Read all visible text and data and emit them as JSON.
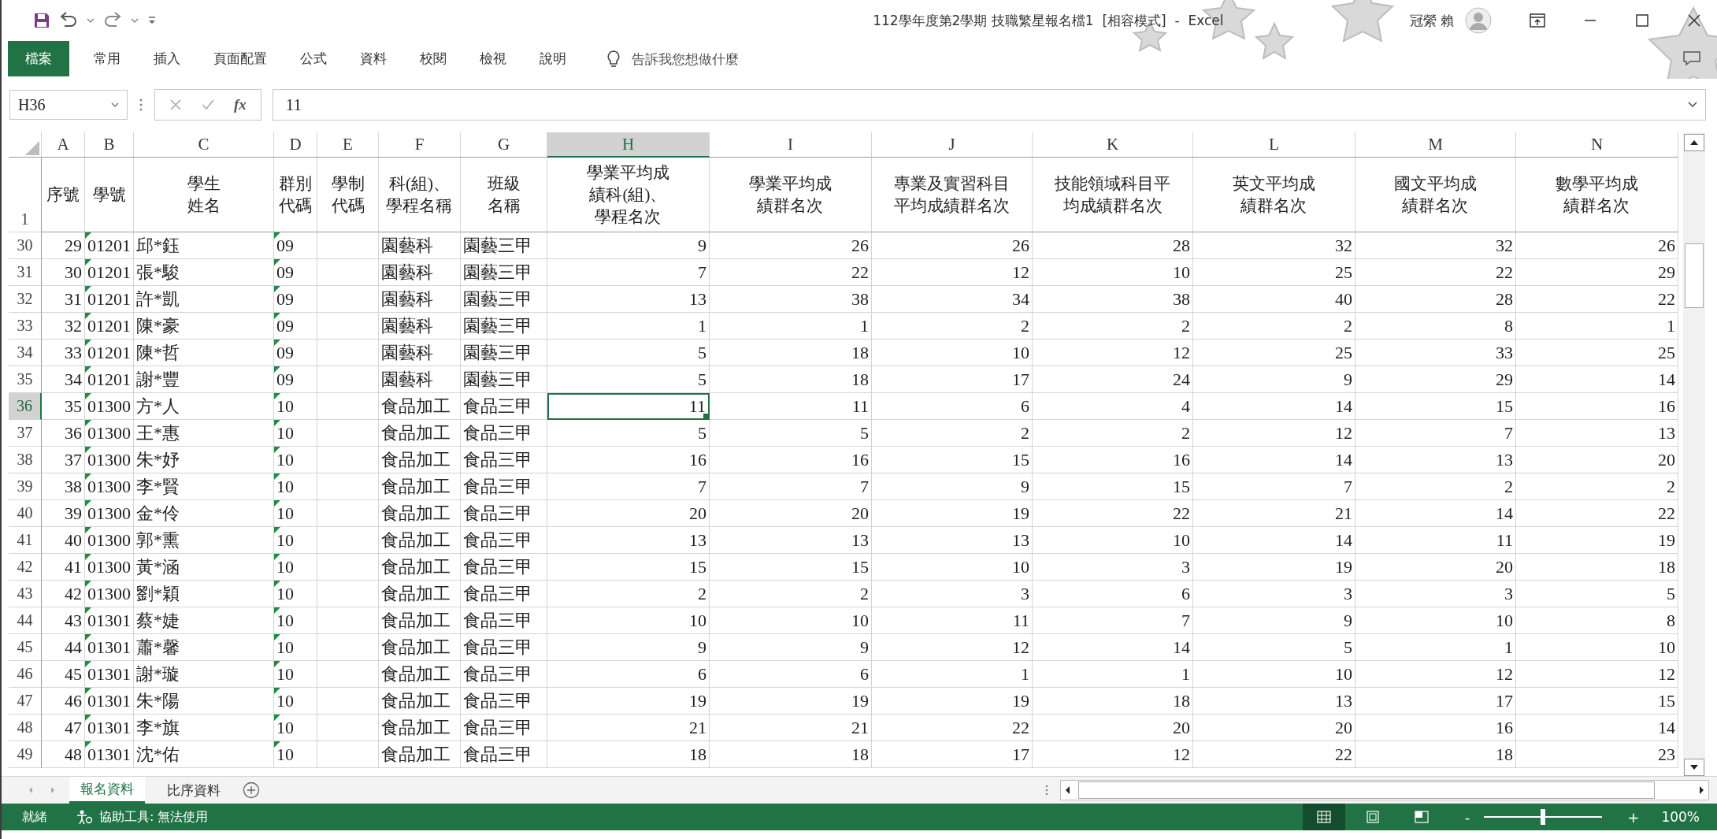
{
  "window": {
    "title": "112學年度第2學期 技職繁星報名檔1  [相容模式]  -  Excel",
    "user": "冠縈 賴"
  },
  "ribbon_tabs": [
    {
      "label": "檔案",
      "kind": "file",
      "selected": false
    },
    {
      "label": "常用",
      "kind": "tab",
      "selected": false
    },
    {
      "label": "插入",
      "kind": "tab",
      "selected": false
    },
    {
      "label": "頁面配置",
      "kind": "tab",
      "selected": false
    },
    {
      "label": "公式",
      "kind": "tab",
      "selected": false
    },
    {
      "label": "資料",
      "kind": "tab",
      "selected": false
    },
    {
      "label": "校閱",
      "kind": "tab",
      "selected": false
    },
    {
      "label": "檢視",
      "kind": "tab",
      "selected": false
    },
    {
      "label": "說明",
      "kind": "tab",
      "selected": false
    }
  ],
  "tell_me": {
    "placeholder": "告訴我您想做什麼"
  },
  "formula_bar": {
    "name_box": "H36",
    "fx": "fx",
    "value": "11"
  },
  "sheet": {
    "header_row_number": "1",
    "columns": [
      {
        "letter": "A",
        "heading": "序號",
        "kind": "number",
        "flag": false,
        "selected": false
      },
      {
        "letter": "B",
        "heading": "學號",
        "kind": "text",
        "flag": true,
        "selected": false
      },
      {
        "letter": "C",
        "heading": "學生姓名",
        "kind": "text",
        "flag": false,
        "selected": false
      },
      {
        "letter": "D",
        "heading": "群別代碼",
        "kind": "text",
        "flag": true,
        "selected": false
      },
      {
        "letter": "E",
        "heading": "學制代碼",
        "kind": "text",
        "flag": false,
        "selected": false
      },
      {
        "letter": "F",
        "heading": "科(組)、學程名稱",
        "kind": "text",
        "flag": false,
        "selected": false
      },
      {
        "letter": "G",
        "heading": "班級名稱",
        "kind": "text",
        "flag": false,
        "selected": false
      },
      {
        "letter": "H",
        "heading": "學業平均成績科(組)、學程名次",
        "kind": "number",
        "flag": false,
        "selected": true
      },
      {
        "letter": "I",
        "heading": "學業平均成績群名次",
        "kind": "number",
        "flag": false,
        "selected": false
      },
      {
        "letter": "J",
        "heading": "專業及實習科目平均成績群名次",
        "kind": "number",
        "flag": false,
        "selected": false
      },
      {
        "letter": "K",
        "heading": "技能領域科目平均成績群名次",
        "kind": "number",
        "flag": false,
        "selected": false
      },
      {
        "letter": "L",
        "heading": "英文平均成績群名次",
        "kind": "number",
        "flag": false,
        "selected": false
      },
      {
        "letter": "M",
        "heading": "國文平均成績群名次",
        "kind": "number",
        "flag": false,
        "selected": false
      },
      {
        "letter": "N",
        "heading": "數學平均成績群名次",
        "kind": "number",
        "flag": false,
        "selected": false
      }
    ],
    "rows": [
      {
        "row": "30",
        "selected": false,
        "cells": {
          "A": "29",
          "B": "01201",
          "C": "邱*鈺",
          "D": "09",
          "F": "園藝科",
          "G": "園藝三甲",
          "H": "9",
          "I": "26",
          "J": "26",
          "K": "28",
          "L": "32",
          "M": "32",
          "N": "26"
        }
      },
      {
        "row": "31",
        "selected": false,
        "cells": {
          "A": "30",
          "B": "01201",
          "C": "張*駿",
          "D": "09",
          "F": "園藝科",
          "G": "園藝三甲",
          "H": "7",
          "I": "22",
          "J": "12",
          "K": "10",
          "L": "25",
          "M": "22",
          "N": "29"
        }
      },
      {
        "row": "32",
        "selected": false,
        "cells": {
          "A": "31",
          "B": "01201",
          "C": "許*凱",
          "D": "09",
          "F": "園藝科",
          "G": "園藝三甲",
          "H": "13",
          "I": "38",
          "J": "34",
          "K": "38",
          "L": "40",
          "M": "28",
          "N": "22"
        }
      },
      {
        "row": "33",
        "selected": false,
        "cells": {
          "A": "32",
          "B": "01201",
          "C": "陳*豪",
          "D": "09",
          "F": "園藝科",
          "G": "園藝三甲",
          "H": "1",
          "I": "1",
          "J": "2",
          "K": "2",
          "L": "2",
          "M": "8",
          "N": "1"
        }
      },
      {
        "row": "34",
        "selected": false,
        "cells": {
          "A": "33",
          "B": "01201",
          "C": "陳*哲",
          "D": "09",
          "F": "園藝科",
          "G": "園藝三甲",
          "H": "5",
          "I": "18",
          "J": "10",
          "K": "12",
          "L": "25",
          "M": "33",
          "N": "25"
        }
      },
      {
        "row": "35",
        "selected": false,
        "cells": {
          "A": "34",
          "B": "01201",
          "C": "謝*豐",
          "D": "09",
          "F": "園藝科",
          "G": "園藝三甲",
          "H": "5",
          "I": "18",
          "J": "17",
          "K": "24",
          "L": "9",
          "M": "29",
          "N": "14"
        }
      },
      {
        "row": "36",
        "selected": true,
        "cells": {
          "A": "35",
          "B": "01300",
          "C": "方*人",
          "D": "10",
          "F": "食品加工",
          "G": "食品三甲",
          "H": "11",
          "I": "11",
          "J": "6",
          "K": "4",
          "L": "14",
          "M": "15",
          "N": "16"
        }
      },
      {
        "row": "37",
        "selected": false,
        "cells": {
          "A": "36",
          "B": "01300",
          "C": "王*惠",
          "D": "10",
          "F": "食品加工",
          "G": "食品三甲",
          "H": "5",
          "I": "5",
          "J": "2",
          "K": "2",
          "L": "12",
          "M": "7",
          "N": "13"
        }
      },
      {
        "row": "38",
        "selected": false,
        "cells": {
          "A": "37",
          "B": "01300",
          "C": "朱*妤",
          "D": "10",
          "F": "食品加工",
          "G": "食品三甲",
          "H": "16",
          "I": "16",
          "J": "15",
          "K": "16",
          "L": "14",
          "M": "13",
          "N": "20"
        }
      },
      {
        "row": "39",
        "selected": false,
        "cells": {
          "A": "38",
          "B": "01300",
          "C": "李*賢",
          "D": "10",
          "F": "食品加工",
          "G": "食品三甲",
          "H": "7",
          "I": "7",
          "J": "9",
          "K": "15",
          "L": "7",
          "M": "2",
          "N": "2"
        }
      },
      {
        "row": "40",
        "selected": false,
        "cells": {
          "A": "39",
          "B": "01300",
          "C": "金*伶",
          "D": "10",
          "F": "食品加工",
          "G": "食品三甲",
          "H": "20",
          "I": "20",
          "J": "19",
          "K": "22",
          "L": "21",
          "M": "14",
          "N": "22"
        }
      },
      {
        "row": "41",
        "selected": false,
        "cells": {
          "A": "40",
          "B": "01300",
          "C": "郭*熏",
          "D": "10",
          "F": "食品加工",
          "G": "食品三甲",
          "H": "13",
          "I": "13",
          "J": "13",
          "K": "10",
          "L": "14",
          "M": "11",
          "N": "19"
        }
      },
      {
        "row": "42",
        "selected": false,
        "cells": {
          "A": "41",
          "B": "01300",
          "C": "黃*涵",
          "D": "10",
          "F": "食品加工",
          "G": "食品三甲",
          "H": "15",
          "I": "15",
          "J": "10",
          "K": "3",
          "L": "19",
          "M": "20",
          "N": "18"
        }
      },
      {
        "row": "43",
        "selected": false,
        "cells": {
          "A": "42",
          "B": "01300",
          "C": "劉*穎",
          "D": "10",
          "F": "食品加工",
          "G": "食品三甲",
          "H": "2",
          "I": "2",
          "J": "3",
          "K": "6",
          "L": "3",
          "M": "3",
          "N": "5"
        }
      },
      {
        "row": "44",
        "selected": false,
        "cells": {
          "A": "43",
          "B": "01301",
          "C": "蔡*婕",
          "D": "10",
          "F": "食品加工",
          "G": "食品三甲",
          "H": "10",
          "I": "10",
          "J": "11",
          "K": "7",
          "L": "9",
          "M": "10",
          "N": "8"
        }
      },
      {
        "row": "45",
        "selected": false,
        "cells": {
          "A": "44",
          "B": "01301",
          "C": "蕭*馨",
          "D": "10",
          "F": "食品加工",
          "G": "食品三甲",
          "H": "9",
          "I": "9",
          "J": "12",
          "K": "14",
          "L": "5",
          "M": "1",
          "N": "10"
        }
      },
      {
        "row": "46",
        "selected": false,
        "cells": {
          "A": "45",
          "B": "01301",
          "C": "謝*璇",
          "D": "10",
          "F": "食品加工",
          "G": "食品三甲",
          "H": "6",
          "I": "6",
          "J": "1",
          "K": "1",
          "L": "10",
          "M": "12",
          "N": "12"
        }
      },
      {
        "row": "47",
        "selected": false,
        "cells": {
          "A": "46",
          "B": "01301",
          "C": "朱*陽",
          "D": "10",
          "F": "食品加工",
          "G": "食品三甲",
          "H": "19",
          "I": "19",
          "J": "19",
          "K": "18",
          "L": "13",
          "M": "17",
          "N": "15"
        }
      },
      {
        "row": "48",
        "selected": false,
        "cells": {
          "A": "47",
          "B": "01301",
          "C": "李*旗",
          "D": "10",
          "F": "食品加工",
          "G": "食品三甲",
          "H": "21",
          "I": "21",
          "J": "22",
          "K": "20",
          "L": "20",
          "M": "16",
          "N": "14"
        }
      },
      {
        "row": "49",
        "selected": false,
        "cells": {
          "A": "48",
          "B": "01301",
          "C": "沈*佑",
          "D": "10",
          "F": "食品加工",
          "G": "食品三甲",
          "H": "18",
          "I": "18",
          "J": "17",
          "K": "12",
          "L": "22",
          "M": "18",
          "N": "23"
        }
      }
    ]
  },
  "sheet_tabs": [
    {
      "label": "報名資料",
      "selected": true
    },
    {
      "label": "比序資料",
      "selected": false
    }
  ],
  "status_bar": {
    "status": "就緒",
    "accessibility": "協助工具: 無法使用",
    "views": [
      {
        "kind": "normal",
        "selected": true
      },
      {
        "kind": "page_layout",
        "selected": false
      },
      {
        "kind": "page_break",
        "selected": false
      }
    ],
    "zoom_out": "-",
    "zoom_in": "+",
    "zoom": {
      "level": 0.5
    },
    "zoom_text": "100%"
  }
}
